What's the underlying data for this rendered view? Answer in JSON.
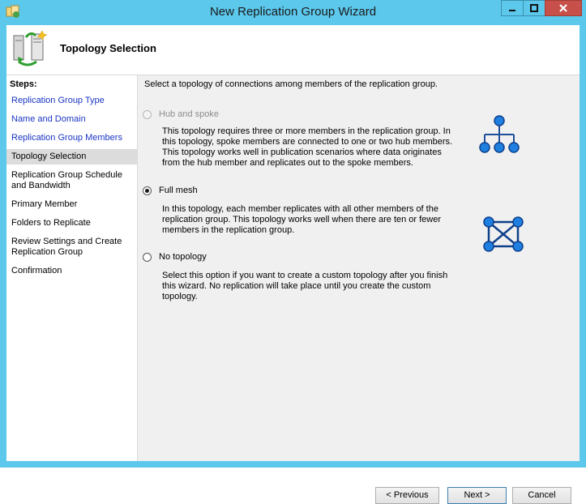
{
  "window": {
    "title": "New Replication Group Wizard"
  },
  "header": {
    "title": "Topology Selection"
  },
  "steps": {
    "title": "Steps:",
    "items": [
      {
        "label": "Replication Group Type"
      },
      {
        "label": "Name and Domain"
      },
      {
        "label": "Replication Group Members"
      },
      {
        "label": "Topology Selection"
      },
      {
        "label": "Replication Group Schedule and Bandwidth"
      },
      {
        "label": "Primary Member"
      },
      {
        "label": "Folders to Replicate"
      },
      {
        "label": "Review Settings and Create Replication Group"
      },
      {
        "label": "Confirmation"
      }
    ]
  },
  "main": {
    "intro": "Select a topology of connections among members of the replication group.",
    "options": [
      {
        "label": "Hub and spoke",
        "description": "This topology requires three or more members in the replication group. In this topology, spoke members are connected to one or two hub members. This topology works well in publication scenarios where data originates from the hub member and replicates out to the spoke members."
      },
      {
        "label": "Full mesh",
        "description": "In this topology, each member replicates with all other members of the replication group. This topology works well when there are ten or fewer members in the replication group."
      },
      {
        "label": "No topology",
        "description": "Select this option if you want to create a custom topology after you finish this wizard. No replication will take place until you create the custom topology."
      }
    ],
    "selected": "Full mesh"
  },
  "buttons": {
    "previous": "< Previous",
    "next": "Next >",
    "cancel": "Cancel"
  },
  "colors": {
    "titlebar": "#5cc8ec",
    "link": "#1a36c4",
    "close_button": "#c7504a",
    "topology_node": "#1e7fe0"
  }
}
